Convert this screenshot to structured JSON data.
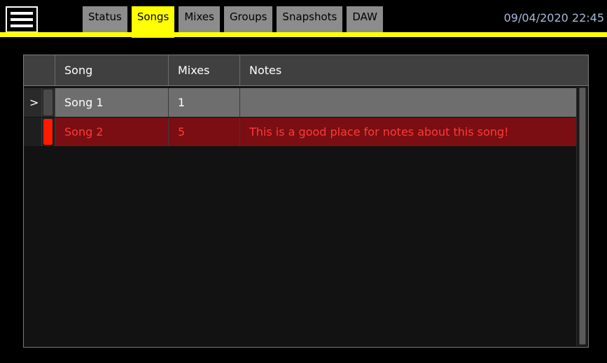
{
  "menu": {
    "icon": "hamburger-menu-icon"
  },
  "tabs": [
    {
      "label": "Status",
      "active": false
    },
    {
      "label": "Songs",
      "active": true
    },
    {
      "label": "Mixes",
      "active": false
    },
    {
      "label": "Groups",
      "active": false
    },
    {
      "label": "Snapshots",
      "active": false
    },
    {
      "label": "DAW",
      "active": false
    }
  ],
  "datetime": "09/04/2020 22:45",
  "table": {
    "columns": {
      "marker": "",
      "song": "Song",
      "mixes": "Mixes",
      "notes": "Notes"
    },
    "rows": [
      {
        "pointer": ">",
        "song": "Song 1",
        "mixes": "1",
        "notes": "",
        "selected": true
      },
      {
        "pointer": "",
        "song": "Song 2",
        "mixes": "5",
        "notes": "This is a good place for notes about this song!",
        "active": true
      }
    ]
  },
  "colors": {
    "accent": "#ffff00",
    "active_row_text": "#ff3a3a",
    "active_row_bg": "#7a0e12",
    "active_indicator": "#ff1a00",
    "selected_row_bg": "#6e6e6e",
    "datetime_text": "#a8b8d8"
  }
}
